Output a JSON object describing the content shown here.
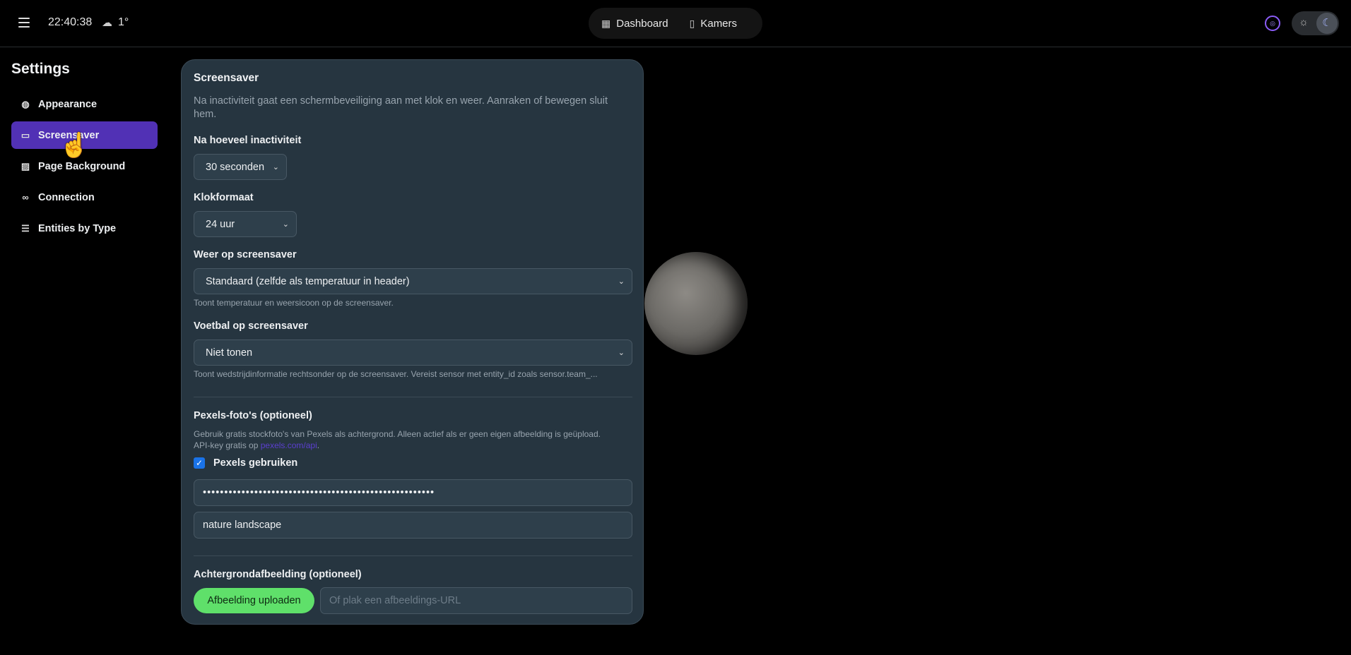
{
  "header": {
    "time": "22:40:38",
    "temperature": "1°",
    "nav": [
      {
        "label": "Dashboard"
      },
      {
        "label": "Kamers"
      }
    ]
  },
  "sidebar": {
    "title": "Settings",
    "items": [
      {
        "label": "Appearance"
      },
      {
        "label": "Screensaver"
      },
      {
        "label": "Page Background"
      },
      {
        "label": "Connection"
      },
      {
        "label": "Entities by Type"
      }
    ],
    "active": "Screensaver"
  },
  "card": {
    "title": "Screensaver",
    "description": "Na inactiviteit gaat een schermbeveiliging aan met klok en weer. Aanraken of bewegen sluit hem.",
    "inactivity": {
      "label": "Na hoeveel inactiviteit",
      "value": "30 seconden"
    },
    "clock": {
      "label": "Klokformaat",
      "value": "24 uur"
    },
    "weather": {
      "label": "Weer op screensaver",
      "value": "Standaard (zelfde als temperatuur in header)",
      "help": "Toont temperatuur en weersicoon op de screensaver."
    },
    "football": {
      "label": "Voetbal op screensaver",
      "value": "Niet tonen",
      "help": "Toont wedstrijdinformatie rechtsonder op de screensaver. Vereist sensor met entity_id zoals sensor.team_..."
    },
    "pexels": {
      "title": "Pexels-foto's (optioneel)",
      "help_line1": "Gebruik gratis stockfoto's van Pexels als achtergrond. Alleen actief als er geen eigen afbeelding is geüpload.",
      "help_prefix": "API-key gratis op ",
      "link": "pexels.com/api",
      "help_suffix": ".",
      "checkbox_label": "Pexels gebruiken",
      "checked": true,
      "api_key": "••••••••••••••••••••••••••••••••••••••••••••••••••••••",
      "query": "nature landscape"
    },
    "background": {
      "title": "Achtergrondafbeelding (optioneel)",
      "upload_label": "Afbeelding uploaden",
      "url_placeholder": "Of plak een afbeeldings-URL"
    }
  },
  "colors": {
    "accent": "#5131b5",
    "upload": "#5fe06a",
    "card": "#263540"
  }
}
